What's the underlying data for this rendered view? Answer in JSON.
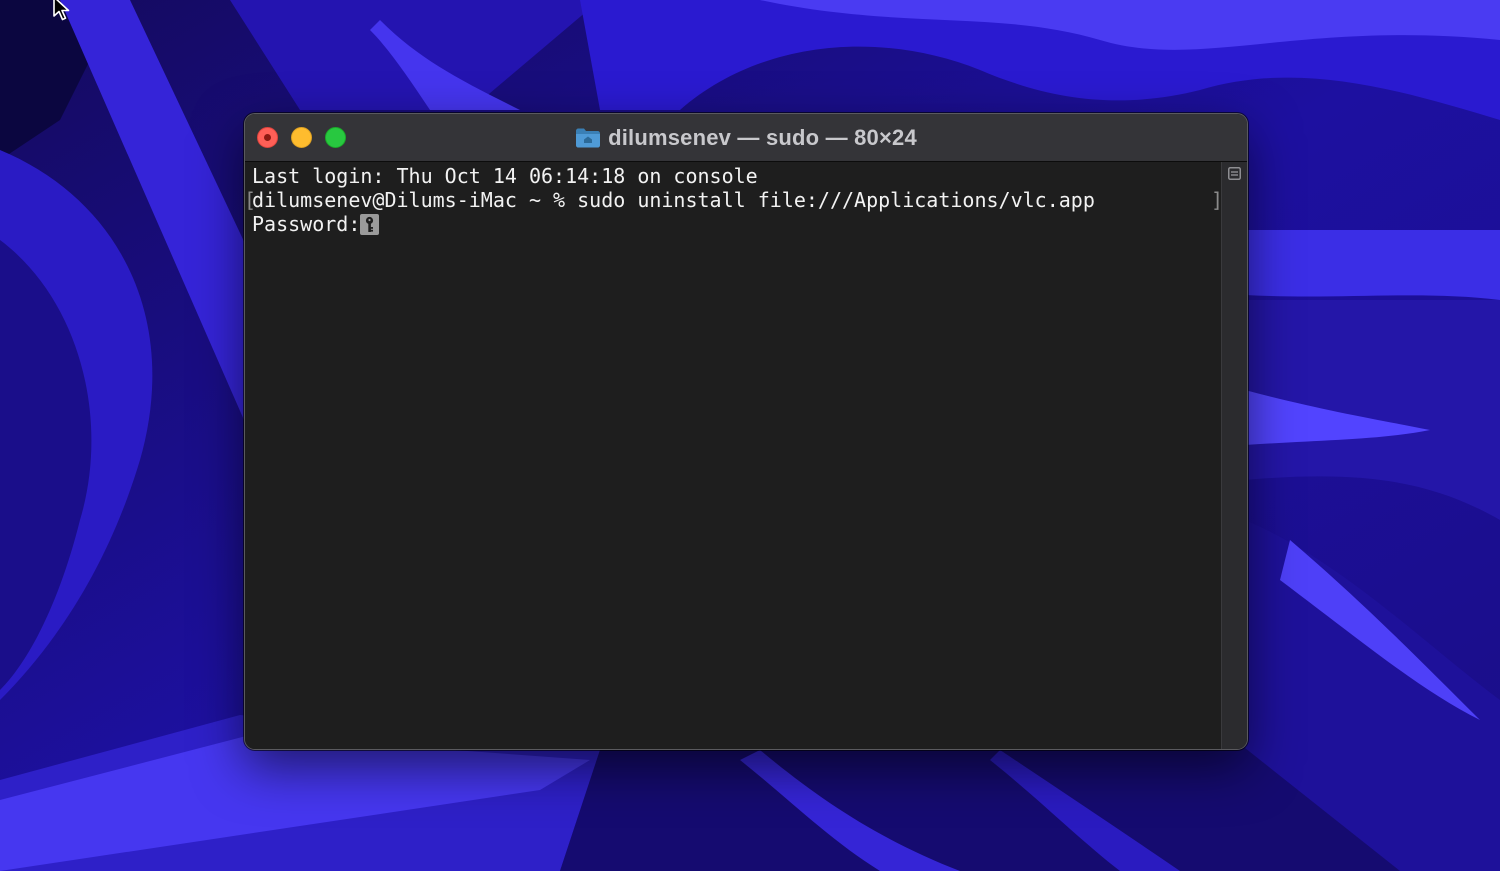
{
  "window": {
    "title": "dilumsenev — sudo — 80×24",
    "title_icon": "folder-icon"
  },
  "terminal": {
    "line1": "Last login: Thu Oct 14 06:14:18 on console",
    "line2": "dilumsenev@Dilums-iMac ~ % sudo uninstall file:///Applications/vlc.app",
    "line3_prompt": "Password:",
    "bracket_left": "[",
    "bracket_right": "]",
    "cursor_icon": "key-icon"
  },
  "colors": {
    "wallpaper_base": "#1a0f7a",
    "wallpaper_accent": "#3b2be0",
    "terminal_bg": "#1e1e1e",
    "terminal_text": "#f2f2f2",
    "titlebar_bg": "#343438",
    "close": "#ff5f57",
    "minimize": "#febc2e",
    "zoom": "#28c840"
  },
  "icons": {
    "pointer": "mouse-pointer-icon",
    "split_pane": "split-pane-icon"
  }
}
